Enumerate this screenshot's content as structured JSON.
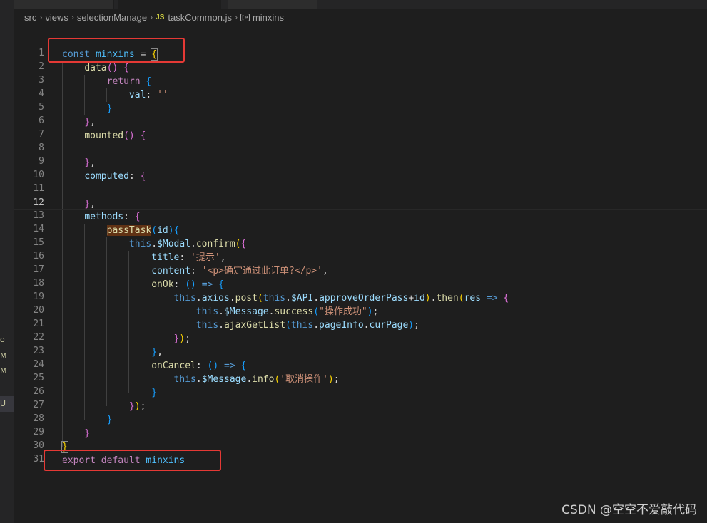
{
  "breadcrumb": {
    "items": [
      "src",
      "views",
      "selectionManage"
    ],
    "file": "taskCommon.js",
    "file_icon": "JS",
    "symbol": "minxins",
    "symbol_icon": "[e]"
  },
  "editor": {
    "current_line": 12,
    "line_numbers": [
      "1",
      "2",
      "3",
      "4",
      "5",
      "6",
      "7",
      "8",
      "9",
      "10",
      "11",
      "12",
      "13",
      "14",
      "15",
      "16",
      "17",
      "18",
      "19",
      "20",
      "21",
      "22",
      "23",
      "24",
      "25",
      "26",
      "27",
      "28",
      "29",
      "30",
      "31"
    ]
  },
  "left_strip": {
    "marks": [
      "o",
      "M",
      "M",
      "U"
    ]
  },
  "colors": {
    "background": "#1e1e1e",
    "keyword": "#569cd6",
    "control": "#c586c0",
    "variable": "#4fc1ff",
    "function": "#dcdcaa",
    "property": "#9cdcfe",
    "string": "#ce9178",
    "annotation": "#e53935"
  },
  "watermark": "CSDN @空空不爱敲代码"
}
